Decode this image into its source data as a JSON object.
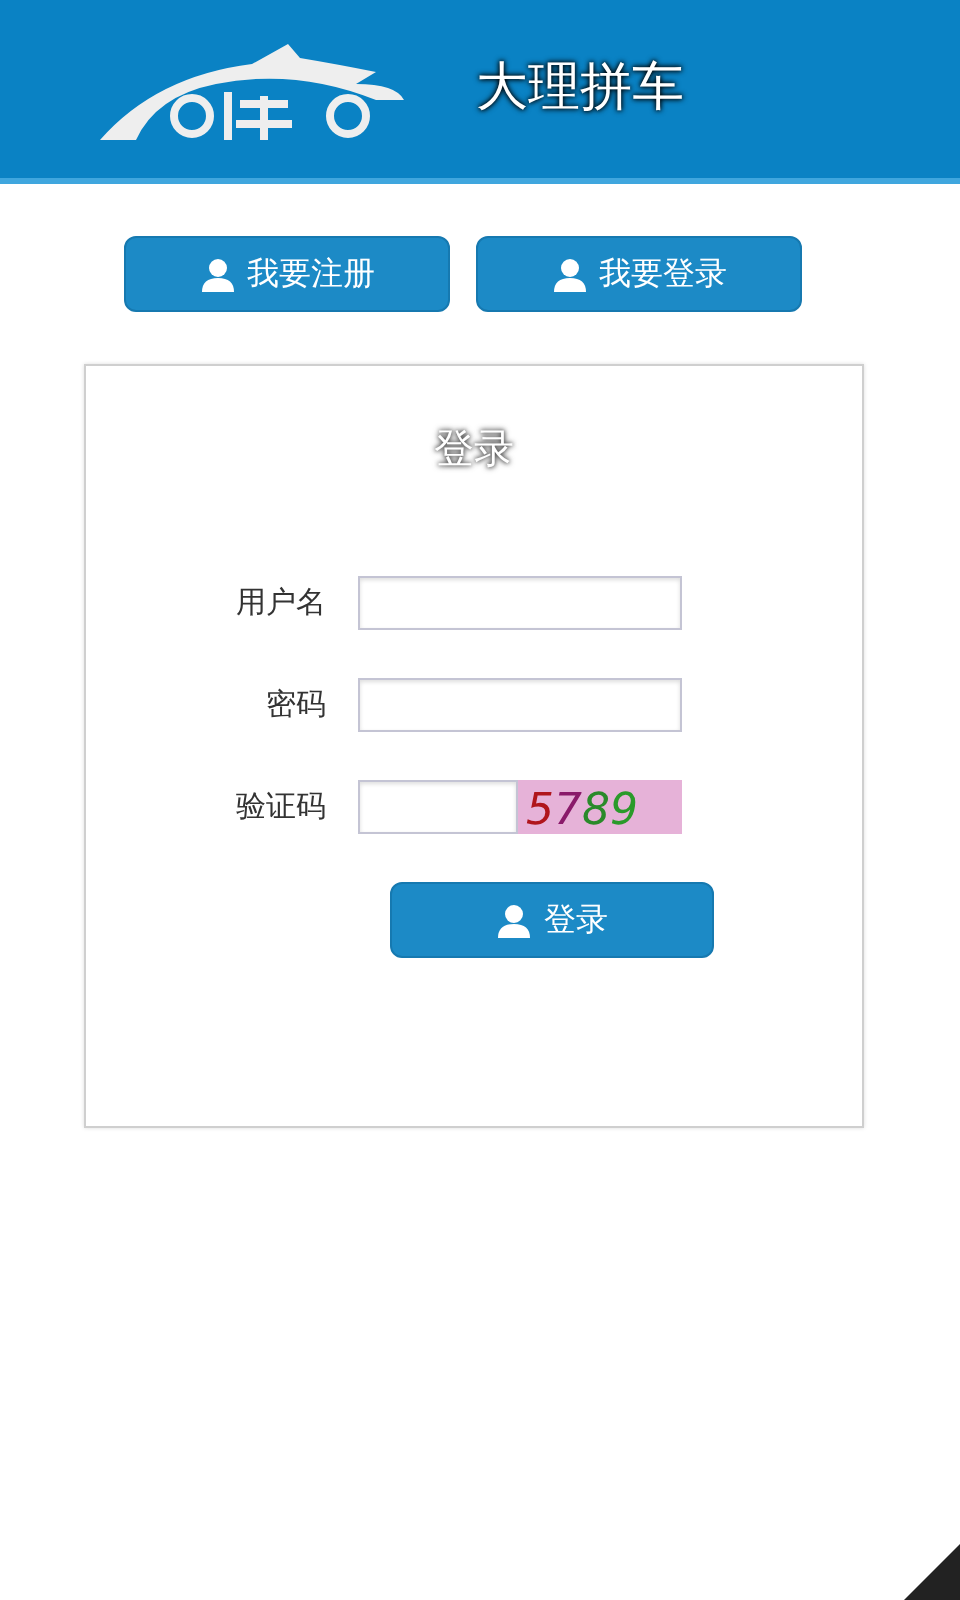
{
  "header": {
    "title": "大理拼车"
  },
  "top_buttons": [
    {
      "label": "我要注册"
    },
    {
      "label": "我要登录"
    }
  ],
  "login_form": {
    "title": "登录",
    "fields": [
      {
        "label": "用户名",
        "kind": "text"
      },
      {
        "label": "密码",
        "kind": "password"
      },
      {
        "label": "验证码",
        "kind": "captcha"
      }
    ],
    "captcha": {
      "digits": [
        {
          "text": "5",
          "color": "#b0151c"
        },
        {
          "text": "7",
          "color": "#8a1a6a"
        },
        {
          "text": "8",
          "color": "#2a8a2a"
        },
        {
          "text": "9",
          "color": "#2a9a2a"
        }
      ]
    },
    "submit": "登录"
  }
}
